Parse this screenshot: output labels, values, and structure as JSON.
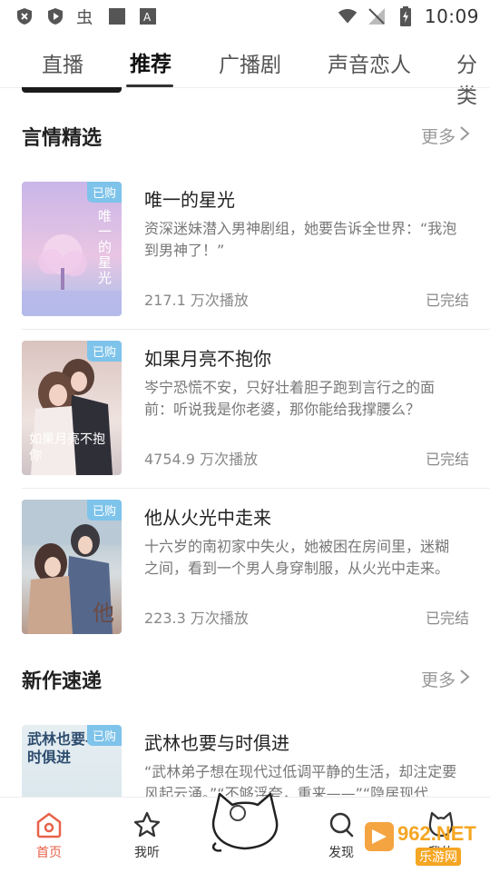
{
  "status_bar": {
    "time": "10:09"
  },
  "tabs": [
    {
      "label": "直播"
    },
    {
      "label": "推荐"
    },
    {
      "label": "广播剧"
    },
    {
      "label": "声音恋人"
    },
    {
      "label": "分类"
    }
  ],
  "sections": [
    {
      "title": "言情精选",
      "more": "更多",
      "books": [
        {
          "badge": "已购",
          "title": "唯一的星光",
          "desc": "资深迷妹潜入男神剧组，她要告诉全世界：“我泡到男神了！”",
          "plays": "217.1 万次播放",
          "status": "已完结",
          "cover_text": "唯一的星光"
        },
        {
          "badge": "已购",
          "title": "如果月亮不抱你",
          "desc": "岑宁恐慌不安，只好壮着胆子跑到言行之的面前：听说我是你老婆，那你能给我撑腰么？",
          "plays": "4754.9 万次播放",
          "status": "已完结",
          "cover_text": "如果月亮不抱你"
        },
        {
          "badge": "已购",
          "title": "他从火光中走来",
          "desc": "十六岁的南初家中失火，她被困在房间里，迷糊之间，看到一个男人身穿制服，从火光中走来。",
          "plays": "223.3 万次播放",
          "status": "已完结",
          "cover_text": "他"
        }
      ]
    },
    {
      "title": "新作速递",
      "more": "更多",
      "books": [
        {
          "badge": "已购",
          "title": "武林也要与时俱进",
          "desc": "“武林弟子想在现代过低调平静的生活，却注定要风起云涌。”“不够浮夸，重来——”“隐居现代",
          "cover_text": "武林也要与时俱进"
        }
      ]
    }
  ],
  "bottom_nav": [
    {
      "label": "首页"
    },
    {
      "label": "我听"
    },
    {
      "label": "发现"
    },
    {
      "label": "我的"
    }
  ],
  "watermark": {
    "line1": "962.NET",
    "line2": "乐游网"
  },
  "colors": {
    "accent": "#e8624a",
    "badge": "#7ec3ea"
  }
}
